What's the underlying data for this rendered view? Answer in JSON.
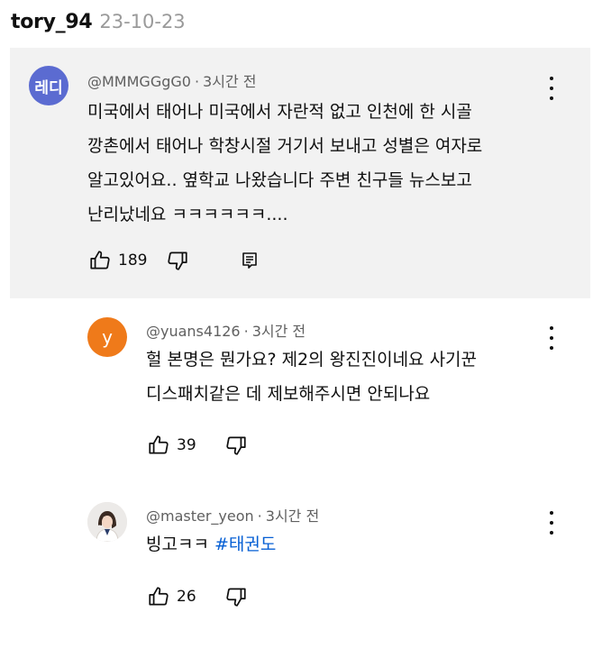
{
  "header": {
    "username": "tory_94",
    "date": "23-10-23"
  },
  "comments": [
    {
      "avatar_text": "레디",
      "avatar_color": "#5b6bd1",
      "handle": "@MMMGGgG0",
      "time": "3시간 전",
      "lines": [
        "미국에서 태어나 미국에서 자란적 없고 인천에 한 시골",
        "깡촌에서 태어나 학창시절 거기서 보내고 성별은 여자로",
        "알고있어요.. 옆학교 나왔습니다 주변 친구들 뉴스보고",
        "난리났네요 ㅋㅋㅋㅋㅋㅋ...."
      ],
      "likes": "189"
    },
    {
      "avatar_text": "y",
      "avatar_color": "#ef7a1a",
      "handle": "@yuans4126",
      "time": "3시간 전",
      "lines": [
        "헐 본명은 뭔가요? 제2의 왕진진이네요 사기꾼",
        "디스패치같은 데 제보해주시면 안되나요"
      ],
      "likes": "39"
    },
    {
      "handle": "@master_yeon",
      "time": "3시간 전",
      "text": "빙고ㅋㅋ",
      "hashtag": "#태권도",
      "likes": "26"
    }
  ]
}
